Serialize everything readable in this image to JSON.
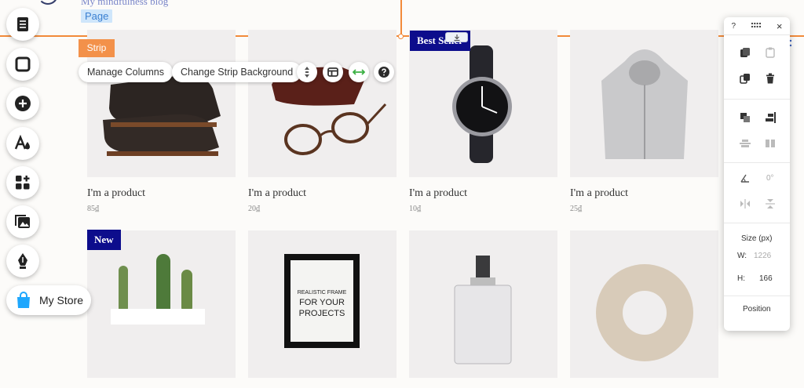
{
  "header": {
    "blog_title": "My mindfulness blog",
    "page_pill": "Page"
  },
  "strip": {
    "tag": "Strip",
    "manage_columns": "Manage Columns",
    "change_background": "Change Strip Background"
  },
  "left_rail": {
    "icons": [
      "menus-pages-icon",
      "background-icon",
      "add-icon",
      "theme-manager-icon",
      "app-market-icon",
      "media-icon",
      "blog-pen-icon"
    ],
    "store_label": "My Store"
  },
  "products": [
    {
      "name": "I'm a product",
      "price": "85₫",
      "ribbon": ""
    },
    {
      "name": "I'm a product",
      "price": "20₫",
      "ribbon": ""
    },
    {
      "name": "I'm a product",
      "price": "10₫",
      "ribbon": "Best Seller"
    },
    {
      "name": "I'm a product",
      "price": "25₫",
      "ribbon": ""
    },
    {
      "name": "",
      "price": "",
      "ribbon": "New"
    },
    {
      "name": "",
      "price": "",
      "ribbon": "",
      "frame_text": [
        "REALISTIC FRAME",
        "FOR YOUR",
        "PROJECTS"
      ]
    },
    {
      "name": "",
      "price": "",
      "ribbon": ""
    },
    {
      "name": "",
      "price": "",
      "ribbon": ""
    }
  ],
  "panel": {
    "help": "?",
    "close": "×",
    "rotation_value": "0°",
    "size_label": "Size (px)",
    "width_label": "W:",
    "width_value": "1226",
    "height_label": "H:",
    "height_value": "166",
    "position_label": "Position"
  },
  "colors": {
    "selection": "#f28a3a",
    "ribbon": "#0d0d8c",
    "page_pill_bg": "#cfe6fb",
    "store_icon": "#1ea7fd"
  }
}
